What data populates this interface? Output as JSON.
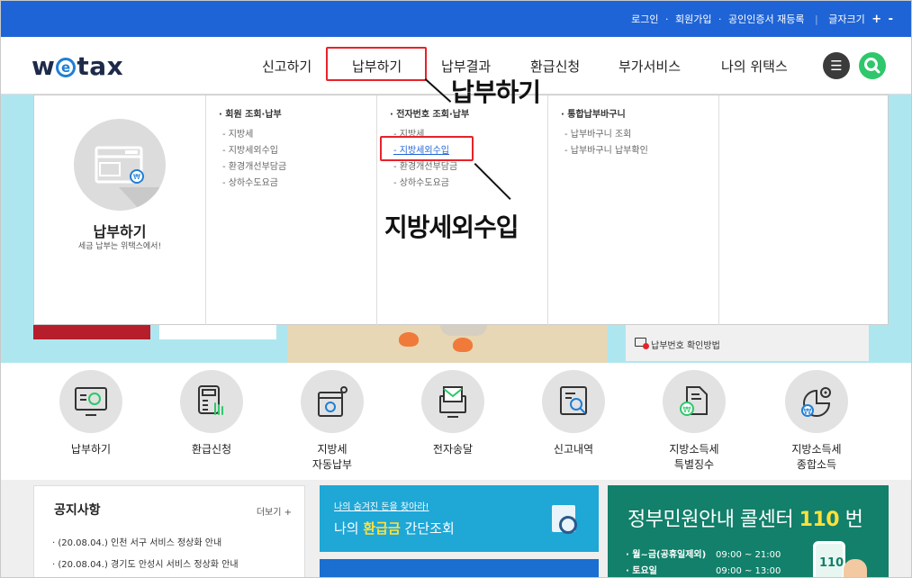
{
  "topbar": {
    "login": "로그인",
    "signup": "회원가입",
    "cert": "공인인증서 재등록",
    "font_size": "글자크기",
    "plus": "+",
    "minus": "-",
    "dot": "·"
  },
  "logo": {
    "pre": "w",
    "e": "e",
    "post": "tax"
  },
  "gnb": {
    "items": [
      "신고하기",
      "납부하기",
      "납부결과",
      "환급신청",
      "부가서비스",
      "나의 위택스"
    ],
    "menu_glyph": "☰"
  },
  "annotations": {
    "menu_callout": "납부하기",
    "submenu_callout": "지방세외수입"
  },
  "mega": {
    "intro_title": "납부하기",
    "intro_sub": "세금 납부는 위택스에서!",
    "columns": [
      {
        "title": "· 회원 조회·납부",
        "links": [
          "- 지방세",
          "- 지방세외수입",
          "- 환경개선부담금",
          "- 상하수도요금"
        ]
      },
      {
        "title": "· 전자번호 조회·납부",
        "links": [
          "- 지방세",
          "- 지방세외수입",
          "- 환경개선부담금",
          "- 상하수도요금"
        ]
      },
      {
        "title": "· 통합납부바구니",
        "links": [
          "- 납부바구니 조회",
          "- 납부바구니 납부확인"
        ]
      }
    ]
  },
  "notice_link": "납부번호 확인방법",
  "services": [
    {
      "label": "납부하기"
    },
    {
      "label": "환급신청"
    },
    {
      "label": "지방세\n자동납부"
    },
    {
      "label": "전자송달"
    },
    {
      "label": "신고내역"
    },
    {
      "label": "지방소득세\n특별징수"
    },
    {
      "label": "지방소득세\n종합소득"
    }
  ],
  "notice": {
    "title": "공지사항",
    "more": "더보기 +",
    "items": [
      "· (20.08.04.) 인천 서구 서비스 정상화 안내",
      "· (20.08.04.) 경기도 안성시 서비스 정상화 안내"
    ]
  },
  "refund": {
    "small": "나의 숨겨진 돈을 찾아라!",
    "big_pre": "나의 ",
    "big_hl": "환급금",
    "big_post": " 간단조회"
  },
  "callcenter": {
    "title_pre": "정부민원안내 콜센터 ",
    "title_num": "110",
    "title_post": " 번",
    "rows": [
      {
        "day": "· 월~금(공휴일제외)",
        "time": "09:00 ~ 21:00"
      },
      {
        "day": "· 토요일",
        "time": "09:00 ~ 13:00"
      }
    ],
    "phone_num": "110"
  }
}
